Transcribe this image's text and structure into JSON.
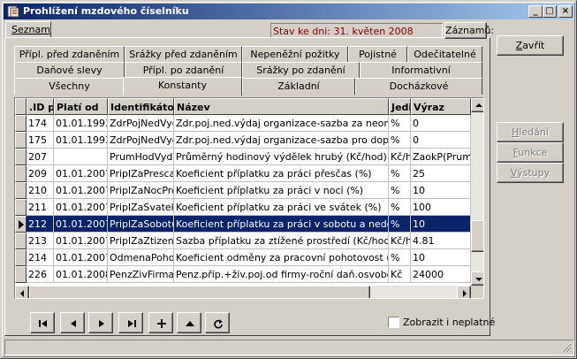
{
  "window": {
    "title": "Prohlížení mzdového číselníku"
  },
  "titlebar_buttons": {
    "minimize": "_",
    "maximize": "□",
    "close": "×"
  },
  "seznam_tab": "Seznam",
  "status": "Stav ke dni: 31. květen 2008",
  "zaznamu_button": "Záznamů:",
  "tabs_row1": [
    "Přípl. před zdaněním",
    "Srážky před zdaněním",
    "Nepeněžní požitky",
    "Pojistné",
    "Odečitatelné"
  ],
  "tabs_row2": [
    "Daňové slevy",
    "Přípl. po zdanění",
    "Srážky po zdanění",
    "Informativní"
  ],
  "tabs_row3": [
    "Všechny",
    "Konstanty",
    "Základní",
    "Docházkové"
  ],
  "active_tab": "Konstanty",
  "columns": [
    ".ID p",
    "Platí od",
    "Identifikátor",
    "Název",
    "Jedi",
    "Výraz"
  ],
  "rows": [
    {
      "id": "174",
      "from": "01.01.1993",
      "ident": "ZdrPojNedVydO",
      "name": "Zdr.poj.ned.výdaj organizace-sazba za neomluv.ne",
      "unit": "%",
      "expr": "0"
    },
    {
      "id": "175",
      "from": "01.01.1993",
      "ident": "ZdrPojNedVydD",
      "name": "Zdr.poj.ned.výdaj organizace-sazba pro doplatek m",
      "unit": "%",
      "expr": "0"
    },
    {
      "id": "207",
      "from": "",
      "ident": "PrumHodVydelek",
      "name": "Průměrný hodinový výdělek hrubý (Kč/hod)",
      "unit": "Kč/h",
      "expr": "ZaokP(Prum"
    },
    {
      "id": "209",
      "from": "01.01.2007",
      "ident": "PriplZaPrescas",
      "name": "Koeficient příplatku za práci přesčas (%)",
      "unit": "%",
      "expr": "25"
    },
    {
      "id": "210",
      "from": "01.01.2007",
      "ident": "PriplZaNocProc",
      "name": "Koeficient příplatku za práci v noci (%)",
      "unit": "%",
      "expr": "10"
    },
    {
      "id": "211",
      "from": "01.01.2007",
      "ident": "PriplZaSvatekP",
      "name": "Koeficient příplatku za práci ve svátek (%)",
      "unit": "%",
      "expr": "100"
    },
    {
      "id": "212",
      "from": "01.01.2007",
      "ident": "PriplZaSobotuA",
      "name": "Koeficient příplatku za práci v sobotu a neděli (%)",
      "unit": "%",
      "expr": "10"
    },
    {
      "id": "213",
      "from": "01.01.2007",
      "ident": "PriplZaZtizene",
      "name": "Sazba příplatku za ztížené prostředí (Kč/hod)",
      "unit": "Kč/h",
      "expr": "4.81"
    },
    {
      "id": "214",
      "from": "01.01.2007",
      "ident": "OdmenaPohotov",
      "name": "Koeficient odměny za pracovní pohotovost (%)",
      "unit": "%",
      "expr": "10"
    },
    {
      "id": "226",
      "from": "01.01.2008",
      "ident": "PenzZivFirmaO",
      "name": "Penz.přip.+živ.poj.od firmy-roční daň.osvobození z",
      "unit": "Kč",
      "expr": "24000"
    }
  ],
  "selected_row_index": 6,
  "show_invalid_label": "Zobrazit i neplatné",
  "show_invalid_checked": false,
  "side_buttons": {
    "zavrit": {
      "label": "Zavřít",
      "enabled": true
    },
    "hledani": {
      "label": "Hledání",
      "enabled": false
    },
    "funkce": {
      "label": "Funkce",
      "enabled": false
    },
    "vystupy": {
      "label": "Výstupy",
      "enabled": false
    }
  },
  "nav_icons": [
    "first-record-icon",
    "previous-record-icon",
    "next-record-icon",
    "last-record-icon",
    "insert-record-icon",
    "delete-record-icon",
    "refresh-icon"
  ]
}
